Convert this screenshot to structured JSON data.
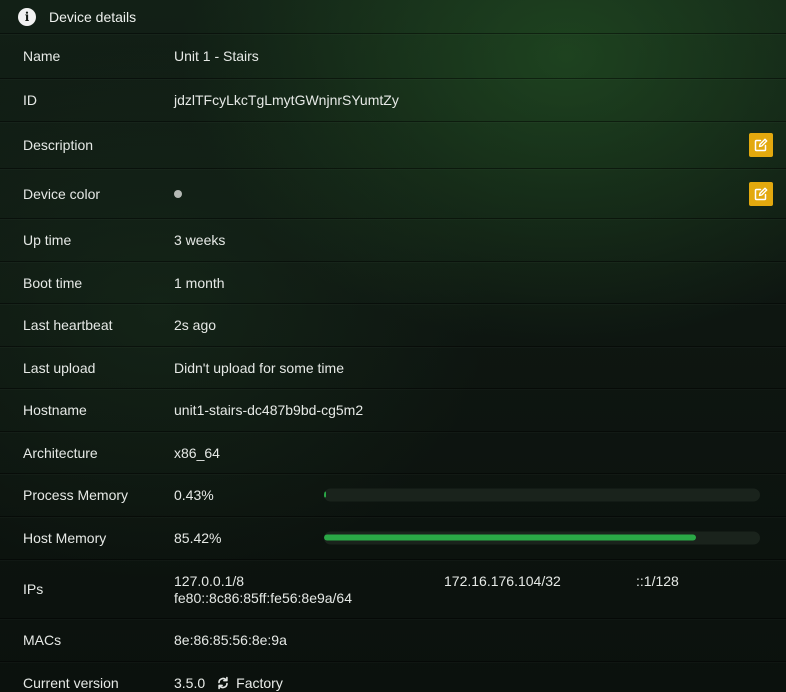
{
  "header": {
    "title": "Device details",
    "icon": "info-icon"
  },
  "rows": {
    "name": {
      "label": "Name",
      "value": "Unit 1 - Stairs"
    },
    "id": {
      "label": "ID",
      "value": "jdzlTFcyLkcTgLmytGWnjnrSYumtZy"
    },
    "description": {
      "label": "Description",
      "value": ""
    },
    "color": {
      "label": "Device color",
      "dot_color": "#b5b9b5"
    },
    "uptime": {
      "label": "Up time",
      "value": "3 weeks"
    },
    "boot": {
      "label": "Boot time",
      "value": "1 month"
    },
    "heartbeat": {
      "label": "Last heartbeat",
      "value": "2s ago"
    },
    "upload": {
      "label": "Last upload",
      "value": "Didn't upload for some time"
    },
    "hostname": {
      "label": "Hostname",
      "value": "unit1-stairs-dc487b9bd-cg5m2"
    },
    "arch": {
      "label": "Architecture",
      "value": "x86_64"
    },
    "process_memory": {
      "label": "Process Memory",
      "value": "0.43%",
      "percent": 0.43
    },
    "host_memory": {
      "label": "Host Memory",
      "value": "85.42%",
      "percent": 85.42
    },
    "ips": {
      "label": "IPs",
      "values": [
        "127.0.0.1/8",
        "fe80::8c86:85ff:fe56:8e9a/64",
        "172.16.176.104/32",
        "::1/128"
      ]
    },
    "macs": {
      "label": "MACs",
      "value": "8e:86:85:56:8e:9a"
    },
    "version": {
      "label": "Current version",
      "value": "3.5.0",
      "channel": "Factory",
      "icon": "sync-icon"
    }
  },
  "colors": {
    "accent_edit": "#e3a90e",
    "progress_fill": "#2aa846",
    "progress_track": "#1a231c"
  }
}
